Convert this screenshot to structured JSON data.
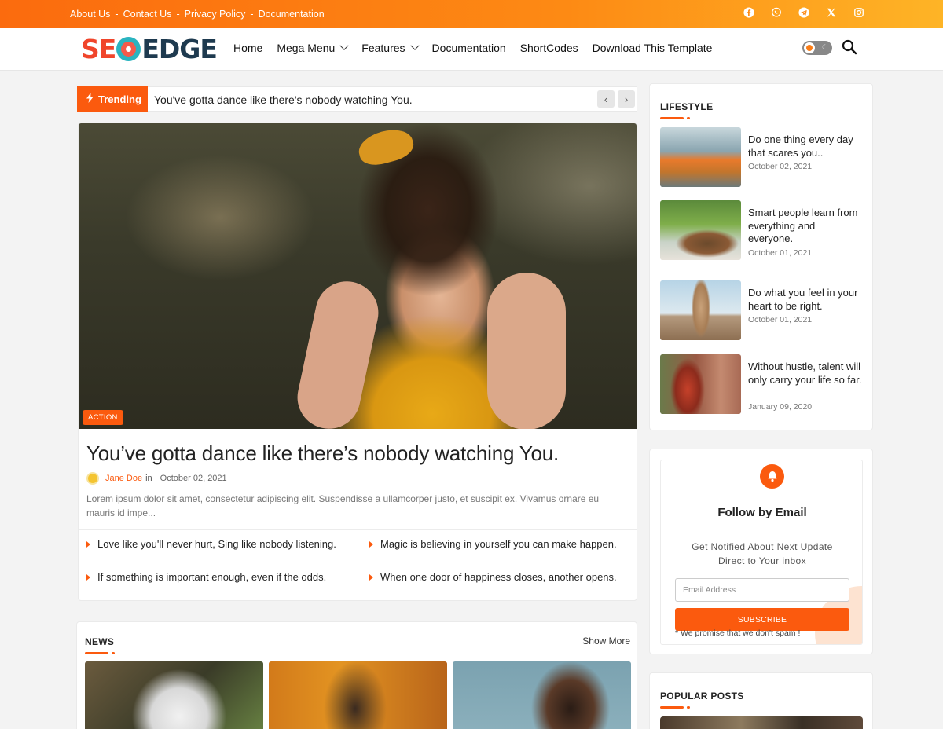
{
  "topbar": {
    "links": [
      "About Us",
      "Contact Us",
      "Privacy Policy",
      "Documentation"
    ],
    "separator": "-",
    "socials": [
      "facebook-icon",
      "whatsapp-icon",
      "telegram-icon",
      "x-icon",
      "instagram-icon"
    ],
    "gradient": [
      "#fb6b0e",
      "#feb426"
    ]
  },
  "header": {
    "logo_left": "SE",
    "logo_right": "EDGE",
    "nav": [
      "Home",
      "Mega Menu",
      "Features",
      "Documentation",
      "ShortCodes",
      "Download This Template"
    ],
    "nav_dropdowns": [
      "Mega Menu",
      "Features"
    ]
  },
  "trending": {
    "label": "Trending",
    "text": "You've gotta dance like there's nobody watching You.",
    "prev": "‹",
    "next": "›"
  },
  "featured": {
    "badge": "ACTION",
    "title": "You’ve gotta dance like there’s nobody watching You.",
    "author": "Jane Doe",
    "in": "in",
    "date": "October 02, 2021",
    "excerpt": "Lorem ipsum dolor sit amet, consectetur adipiscing elit. Suspendisse a ullamcorper justo, et suscipit ex. Vivamus ornare eu mauris id impe...",
    "list": [
      "Love like you'll never hurt, Sing like nobody listening.",
      "Magic is believing in yourself you can make happen.",
      "If something is important enough, even if the odds.",
      "When one door of happiness closes, another opens."
    ]
  },
  "news": {
    "title": "NEWS",
    "show_more": "Show More"
  },
  "lifestyle": {
    "title": "LIFESTYLE",
    "posts": [
      {
        "title": "Do one thing every day that scares you..",
        "date": "October 02, 2021"
      },
      {
        "title": "Smart people learn from everything and everyone.",
        "date": "October 01, 2021"
      },
      {
        "title": "Do what you feel in your heart to be right.",
        "date": "October 01, 2021"
      },
      {
        "title": "Without hustle, talent will only carry your life so far.",
        "date": "January 09, 2020"
      }
    ]
  },
  "follow": {
    "title": "Follow by Email",
    "subtitle_line1": "Get Notified About Next Update",
    "subtitle_line2": "Direct to Your inbox",
    "email_placeholder": "Email Address",
    "subscribe": "SUBSCRIBE",
    "promise": "* We promise that we don't spam !"
  },
  "popular": {
    "title": "POPULAR POSTS"
  },
  "colors": {
    "accent": "#fb5a0e",
    "logo_red": "#f0452b",
    "logo_navy": "#1e3a4f"
  }
}
